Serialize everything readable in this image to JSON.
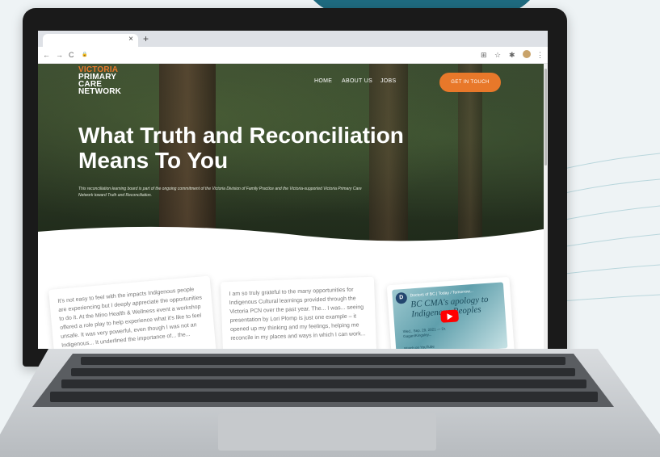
{
  "browser": {
    "tab_close": "×",
    "new_tab": "+",
    "nav_back": "←",
    "nav_forward": "→",
    "nav_reload": "C",
    "address_icon": "🔒",
    "toolbar_icons": [
      "⊞",
      "☆",
      "✱",
      "⋮"
    ]
  },
  "site": {
    "logo": [
      "VICTORIA",
      "PRIMARY",
      "CARE",
      "NETWORK"
    ],
    "menu": [
      "HOME",
      "ABOUT US",
      "JOBS"
    ],
    "cta": "GET IN TOUCH",
    "hero_title": "What Truth and Reconciliation Means To You",
    "hero_sub": "This reconciliation learning board is part of the ongoing commitment of the Victoria Division of Family Practice and the Victoria-supported Victoria Primary Care Network toward Truth and Reconciliation."
  },
  "cards": [
    {
      "text": "It's not easy to feel with the impacts Indigenous people are experiencing but I deeply appreciate the opportunities to do it. At the Mino Health & Wellness event a workshop offered a role play to help experience what it's like to feel unsafe. It was very powerful, even though I was not an Indigenous... It underlined the importance of... the..."
    },
    {
      "text": "I am so truly grateful to the many opportunities for Indigenous Cultural learnings provided through the Victoria PCN over the past year. The... I was... seeing presentation by Lori Plomp is just one example – it opened up my thinking and my feelings, helping me reconcile in my places and ways in which I can work..."
    }
  ],
  "video": {
    "channel": "Doctors of BC | Today / Tomorrow...",
    "badge": "D",
    "title": "BC CMA's apology to Indigenous Peoples",
    "date": "Wed., Sep. 29, 2021 — Dr. Gagan/Kingsley...",
    "watch": "Watch on YouTube"
  },
  "colors": {
    "accent": "#e8782a",
    "backdrop_ring": "#1f6b80"
  }
}
